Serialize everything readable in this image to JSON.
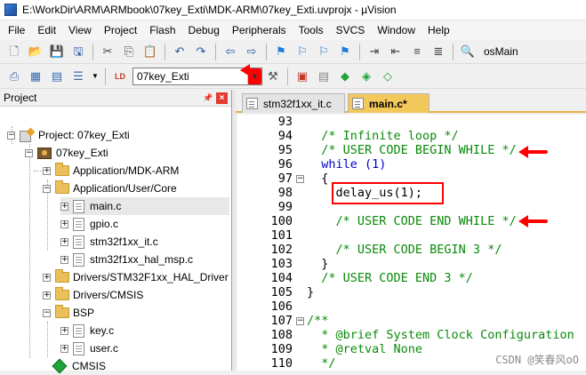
{
  "window": {
    "title": "E:\\WorkDir\\ARM\\ARMbook\\07key_Exti\\MDK-ARM\\07key_Exti.uvprojx - µVision"
  },
  "menu": [
    "File",
    "Edit",
    "View",
    "Project",
    "Flash",
    "Debug",
    "Peripherals",
    "Tools",
    "SVCS",
    "Window",
    "Help"
  ],
  "toolbar": {
    "find_text": "osMain",
    "target_name": "07key_Exti"
  },
  "project_panel": {
    "title": "Project",
    "items": [
      {
        "label": "Project: 07key_Exti",
        "kind": "project",
        "expanded": true
      },
      {
        "label": "07key_Exti",
        "kind": "target",
        "expanded": true
      },
      {
        "label": "Application/MDK-ARM",
        "kind": "folder",
        "expanded": false
      },
      {
        "label": "Application/User/Core",
        "kind": "folder",
        "expanded": true
      },
      {
        "label": "main.c",
        "kind": "file",
        "selected": true
      },
      {
        "label": "gpio.c",
        "kind": "file"
      },
      {
        "label": "stm32f1xx_it.c",
        "kind": "file"
      },
      {
        "label": "stm32f1xx_hal_msp.c",
        "kind": "file"
      },
      {
        "label": "Drivers/STM32F1xx_HAL_Driver",
        "kind": "folder",
        "expanded": false
      },
      {
        "label": "Drivers/CMSIS",
        "kind": "folder",
        "expanded": false
      },
      {
        "label": "BSP",
        "kind": "folder",
        "expanded": true
      },
      {
        "label": "key.c",
        "kind": "file"
      },
      {
        "label": "user.c",
        "kind": "file"
      },
      {
        "label": "CMSIS",
        "kind": "component"
      }
    ]
  },
  "editor": {
    "tabs": [
      {
        "label": "stm32f1xx_it.c",
        "active": false
      },
      {
        "label": "main.c*",
        "active": true
      }
    ],
    "lines": [
      {
        "n": "93",
        "text": ""
      },
      {
        "n": "94",
        "text": "  /* Infinite loop */"
      },
      {
        "n": "95",
        "text": "  /* USER CODE BEGIN WHILE */"
      },
      {
        "n": "96",
        "text": "  while (1)"
      },
      {
        "n": "97",
        "text": "  {"
      },
      {
        "n": "98",
        "text": "    delay_us(1);"
      },
      {
        "n": "99",
        "text": ""
      },
      {
        "n": "100",
        "text": "    /* USER CODE END WHILE */"
      },
      {
        "n": "101",
        "text": ""
      },
      {
        "n": "102",
        "text": "    /* USER CODE BEGIN 3 */"
      },
      {
        "n": "103",
        "text": "  }"
      },
      {
        "n": "104",
        "text": "  /* USER CODE END 3 */"
      },
      {
        "n": "105",
        "text": "}"
      },
      {
        "n": "106",
        "text": ""
      },
      {
        "n": "107",
        "text": "/**"
      },
      {
        "n": "108",
        "text": "  * @brief System Clock Configuration"
      },
      {
        "n": "109",
        "text": "  * @retval None"
      },
      {
        "n": "110",
        "text": "  */"
      }
    ]
  },
  "watermark": "CSDN @笑春风oO"
}
